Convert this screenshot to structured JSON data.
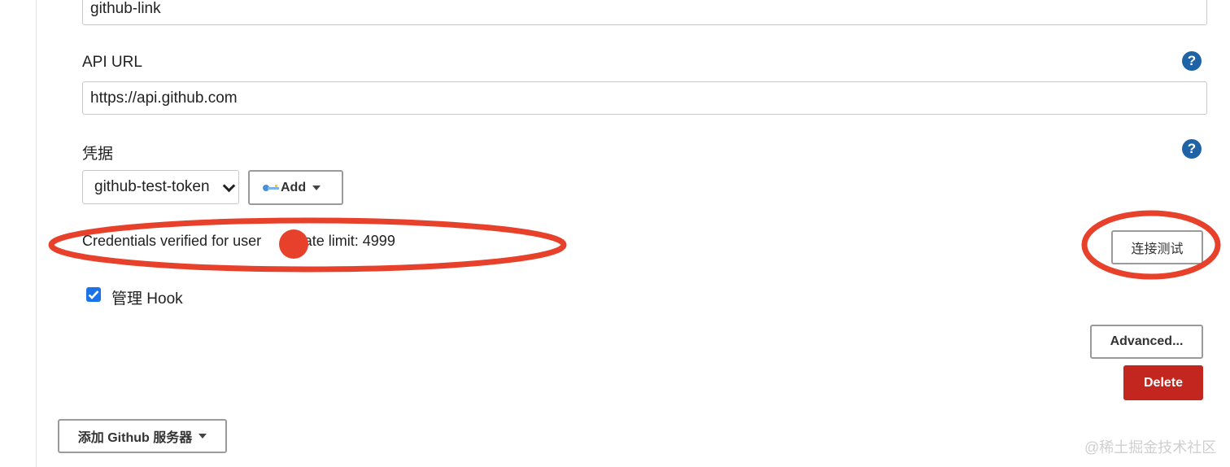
{
  "fields": {
    "name_value": "github-link",
    "api_url_label": "API URL",
    "api_url_value": "https://api.github.com",
    "credentials_label": "凭据",
    "credentials_selected": "github-test-token",
    "add_button_label": "Add"
  },
  "help": {
    "glyph": "?"
  },
  "status": {
    "message": "Credentials verified for user ",
    "suffix": "y, rate limit: 4999"
  },
  "buttons": {
    "test_connection": "连接测试",
    "advanced": "Advanced...",
    "delete": "Delete",
    "add_server": "添加 Github 服务器"
  },
  "manage_hook": {
    "label": "管理 Hook",
    "checked": true
  },
  "watermark": "@稀土掘金技术社区",
  "colors": {
    "help_blue": "#1f63a6",
    "delete_red": "#c3261e",
    "annotation_red": "#e8412b",
    "checkbox_blue": "#1a73e8"
  }
}
